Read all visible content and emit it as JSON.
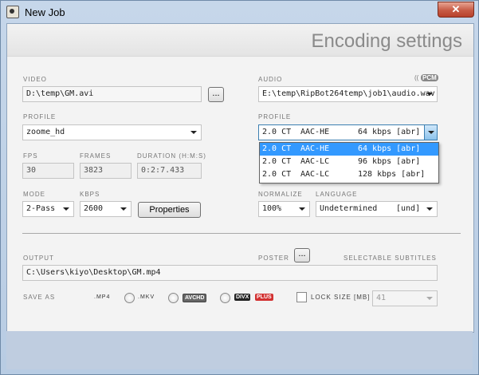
{
  "window": {
    "title": "New Job",
    "close_label": "✕"
  },
  "header": {
    "heading": "Encoding settings"
  },
  "video": {
    "label": "VIDEO",
    "path": "D:\\temp\\GM.avi",
    "browse_label": "..."
  },
  "audio": {
    "label": "AUDIO",
    "badge": "PCM",
    "path": "E:\\temp\\RipBot264temp\\job1\\audio.wav"
  },
  "video_profile": {
    "label": "PROFILE",
    "value": "zoome_hd"
  },
  "audio_profile": {
    "label": "PROFILE",
    "value": {
      "channels": "2.0 CT",
      "codec": "AAC-HE",
      "bitrate": "64 kbps [abr]"
    },
    "options": [
      {
        "channels": "2.0 CT",
        "codec": "AAC-HE",
        "bitrate": "64 kbps [abr]",
        "selected": true
      },
      {
        "channels": "2.0 CT",
        "codec": "AAC-LC",
        "bitrate": "96 kbps [abr]",
        "selected": false
      },
      {
        "channels": "2.0 CT",
        "codec": "AAC-LC",
        "bitrate": "128 kbps [abr]",
        "selected": false
      }
    ]
  },
  "fps": {
    "label": "FPS",
    "value": "30"
  },
  "frames": {
    "label": "FRAMES",
    "value": "3823"
  },
  "duration": {
    "label": "DURATION (H:M:S)",
    "value": "0:2:7.433"
  },
  "mode": {
    "label": "MODE",
    "value": "2-Pass"
  },
  "kbps": {
    "label": "KBPS",
    "value": "2600"
  },
  "properties_label": "Properties",
  "normalize": {
    "label": "NORMALIZE",
    "value": "100%"
  },
  "language": {
    "label": "LANGUAGE",
    "value": "Undetermined",
    "code": "[und]"
  },
  "output": {
    "label": "OUTPUT",
    "path": "C:\\Users\\kiyo\\Desktop\\GM.mp4"
  },
  "poster": {
    "label": "POSTER",
    "browse_label": "..."
  },
  "subtitles_label": "SELECTABLE SUBTITLES",
  "save_as": {
    "label": "SAVE AS",
    "mp4": ".MP4",
    "mkv": ".MKV",
    "avchd": "AVCHD",
    "divx_a": "DIVX",
    "divx_b": "PLUS"
  },
  "lock_size": {
    "label": "LOCK SIZE [MB]",
    "value": "41"
  },
  "colors": {
    "accent": "#3399ff",
    "close": "#c75b45"
  }
}
